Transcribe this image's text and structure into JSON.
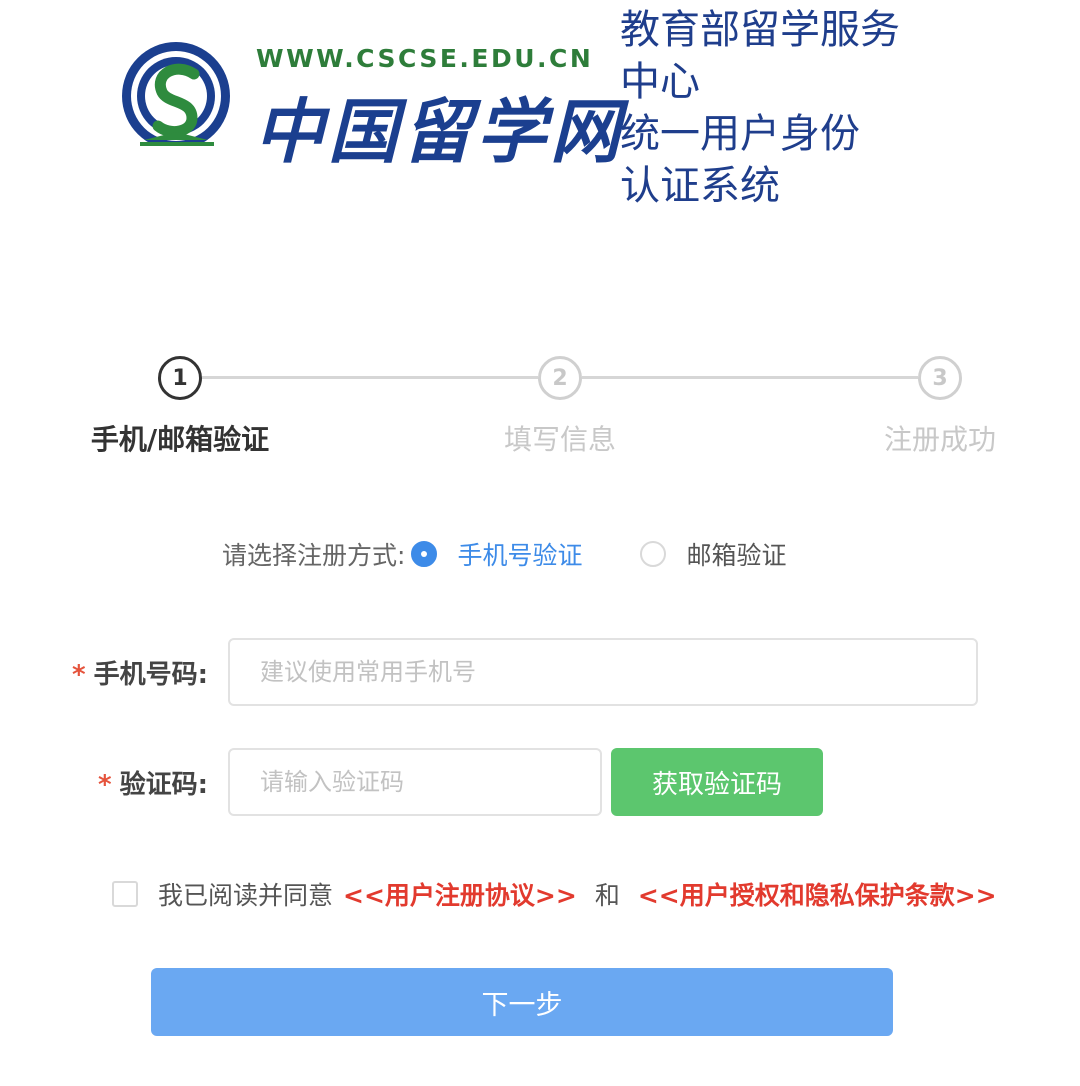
{
  "header": {
    "logo_url_text": "WWW.CSCSE.EDU.CN",
    "logo_brand_text": "中国留学网",
    "system_title_lines": [
      "教育部留学服务",
      "中心",
      "统一用户身份",
      "认证系统"
    ]
  },
  "steps": [
    {
      "number": "1",
      "label": "手机/邮箱验证",
      "state": "active"
    },
    {
      "number": "2",
      "label": "填写信息",
      "state": "todo"
    },
    {
      "number": "3",
      "label": "注册成功",
      "state": "todo"
    }
  ],
  "method": {
    "prompt": "请选择注册方式:",
    "options": [
      {
        "label": "手机号验证",
        "selected": true
      },
      {
        "label": "邮箱验证",
        "selected": false
      }
    ]
  },
  "form": {
    "required_mark": "*",
    "phone": {
      "label": "手机号码:",
      "value": "",
      "placeholder": "建议使用常用手机号"
    },
    "code": {
      "label": "验证码:",
      "value": "",
      "placeholder": "请输入验证码"
    },
    "get_code_button": "获取验证码"
  },
  "agreement": {
    "checked": false,
    "prefix": "我已阅读并同意",
    "link1": "<<用户注册协议>>",
    "conjunction": "和",
    "link2": "<<用户授权和隐私保护条款>>"
  },
  "next_button": "下一步",
  "colors": {
    "accent_blue": "#3d8be8",
    "next_button": "#6aa8f2",
    "code_button": "#5cc66e",
    "link_red": "#e23a2e",
    "title_blue": "#1f3e8c"
  }
}
